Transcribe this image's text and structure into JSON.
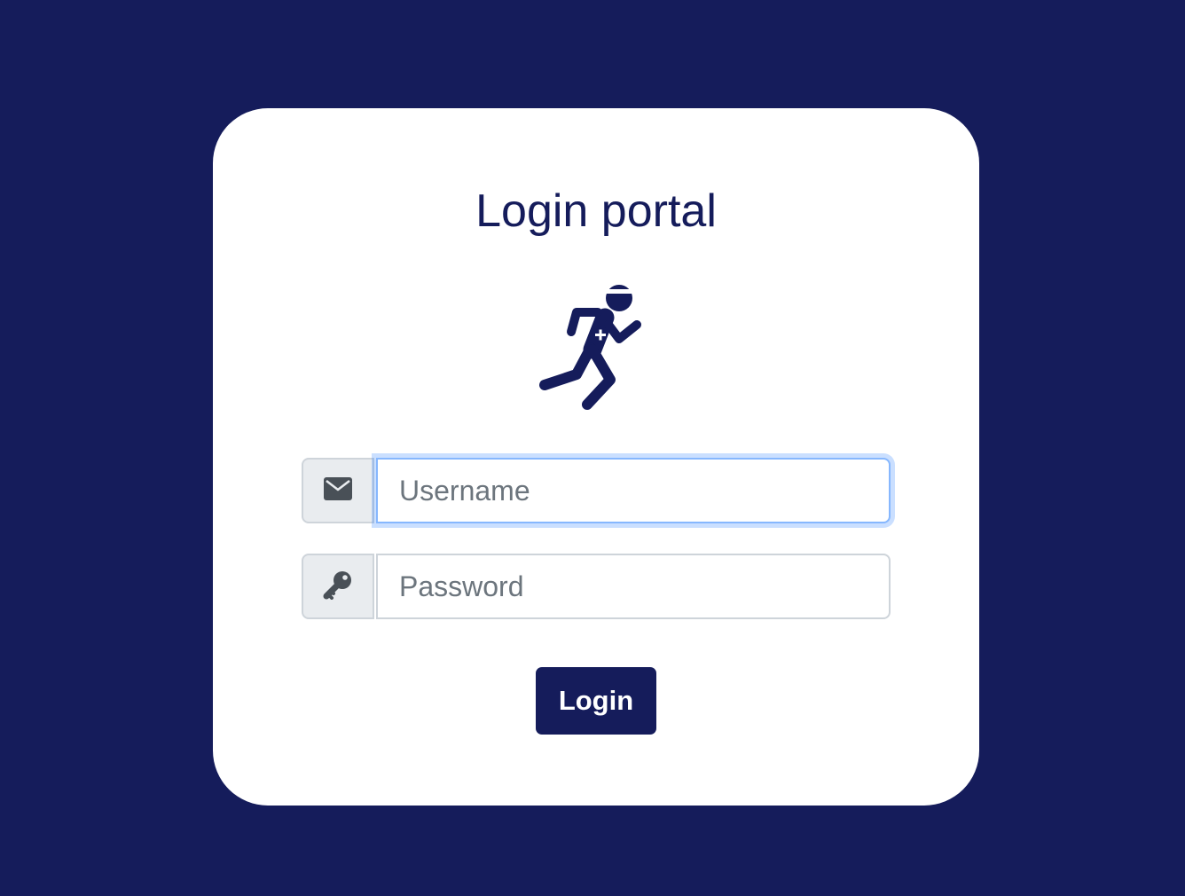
{
  "login": {
    "title": "Login portal",
    "username": {
      "placeholder": "Username",
      "value": "",
      "icon": "envelope-icon"
    },
    "password": {
      "placeholder": "Password",
      "value": "",
      "icon": "key-icon"
    },
    "submit_label": "Login",
    "logo_icon": "running-person-icon"
  },
  "colors": {
    "background": "#151c5b",
    "card": "#ffffff",
    "accent": "#151c5b",
    "addon_background": "#e9ecef",
    "focus_ring": "#86b7fe"
  }
}
